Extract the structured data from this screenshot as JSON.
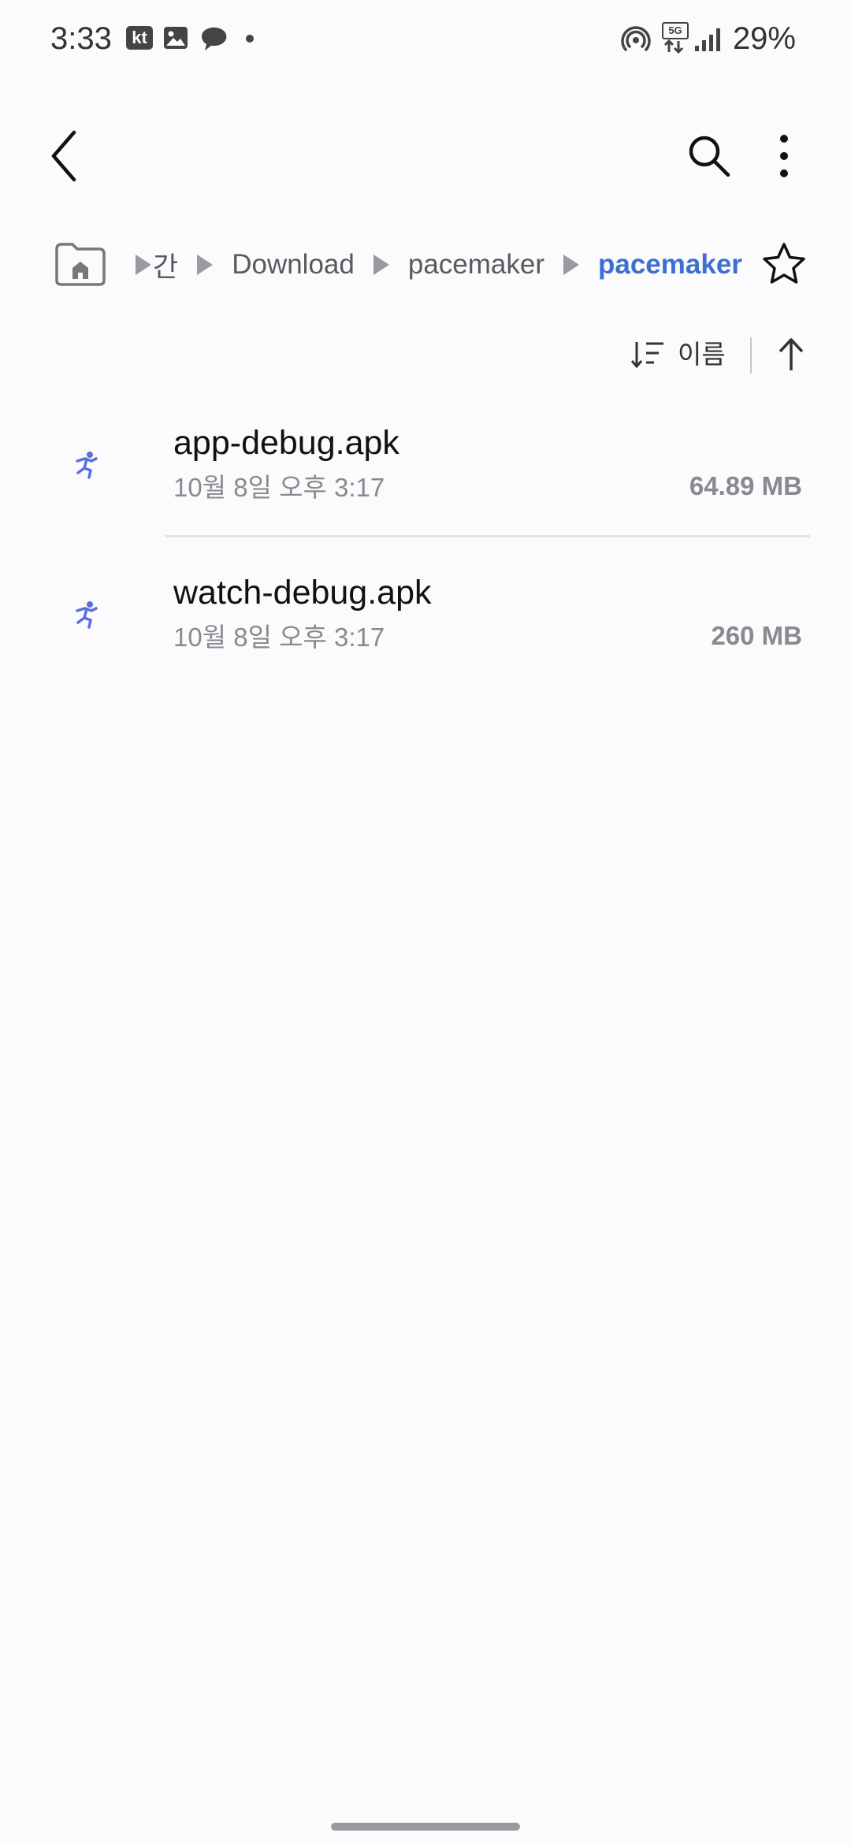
{
  "status_bar": {
    "time": "3:33",
    "carrier_badge": "kt",
    "network_badge": "5G",
    "battery": "29%"
  },
  "toolbar": {
    "back_icon": "chevron-left-icon",
    "search_icon": "search-icon",
    "more_icon": "more-vert-icon"
  },
  "breadcrumb": {
    "home_icon": "home-folder-icon",
    "items": [
      "간",
      "Download",
      "pacemaker",
      "pacemaker"
    ],
    "accent_color": "#3d6fd1"
  },
  "sort": {
    "label": "이름",
    "direction": "ascending"
  },
  "files": [
    {
      "name": "app-debug.apk",
      "date": "10월 8일 오후 3:17",
      "size": "64.89 MB",
      "icon": "running-figure-icon"
    },
    {
      "name": "watch-debug.apk",
      "date": "10월 8일 오후 3:17",
      "size": "260 MB",
      "icon": "running-figure-icon"
    }
  ]
}
